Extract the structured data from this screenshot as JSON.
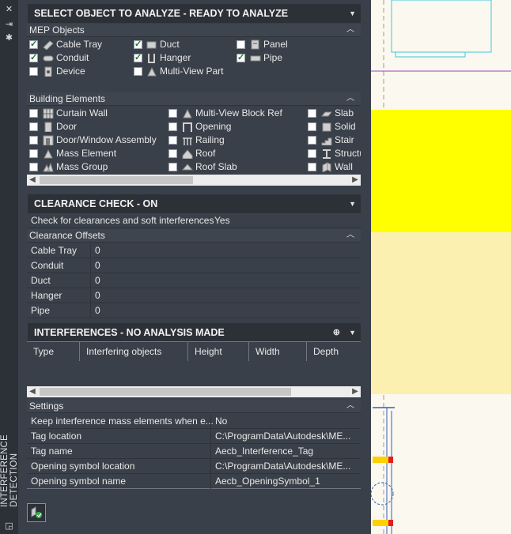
{
  "palette_title": "INTERFERENCE DETECTION",
  "select_header": "SELECT OBJECT TO ANALYZE - READY TO ANALYZE",
  "mep_objects": {
    "label": "MEP Objects",
    "items": [
      {
        "label": "Cable Tray",
        "checked": true,
        "icon": "cable-tray-icon"
      },
      {
        "label": "Duct",
        "checked": true,
        "icon": "duct-icon"
      },
      {
        "label": "Panel",
        "checked": false,
        "icon": "panel-icon"
      },
      {
        "label": "Conduit",
        "checked": true,
        "icon": "conduit-icon"
      },
      {
        "label": "Hanger",
        "checked": true,
        "icon": "hanger-icon"
      },
      {
        "label": "Pipe",
        "checked": true,
        "icon": "pipe-icon"
      },
      {
        "label": "Device",
        "checked": false,
        "icon": "device-icon"
      },
      {
        "label": "Multi-View Part",
        "checked": false,
        "icon": "multi-view-part-icon"
      }
    ]
  },
  "building_elements": {
    "label": "Building Elements",
    "items": [
      {
        "label": "Curtain Wall",
        "checked": false,
        "icon": "curtain-wall-icon"
      },
      {
        "label": "Multi-View Block Ref",
        "checked": false,
        "icon": "multi-view-block-icon"
      },
      {
        "label": "Slab",
        "checked": false,
        "icon": "slab-icon"
      },
      {
        "label": "Door",
        "checked": false,
        "icon": "door-icon"
      },
      {
        "label": "Opening",
        "checked": false,
        "icon": "opening-icon"
      },
      {
        "label": "Solid",
        "checked": false,
        "icon": "solid-icon"
      },
      {
        "label": "Door/Window Assembly",
        "checked": false,
        "icon": "door-window-assembly-icon"
      },
      {
        "label": "Railing",
        "checked": false,
        "icon": "railing-icon"
      },
      {
        "label": "Stair",
        "checked": false,
        "icon": "stair-icon"
      },
      {
        "label": "Mass Element",
        "checked": false,
        "icon": "mass-element-icon"
      },
      {
        "label": "Roof",
        "checked": false,
        "icon": "roof-icon"
      },
      {
        "label": "Structu",
        "checked": false,
        "icon": "structural-member-icon"
      },
      {
        "label": "Mass Group",
        "checked": false,
        "icon": "mass-group-icon"
      },
      {
        "label": "Roof Slab",
        "checked": false,
        "icon": "roof-slab-icon"
      },
      {
        "label": "Wall",
        "checked": false,
        "icon": "wall-icon"
      }
    ]
  },
  "clearance": {
    "header": "CLEARANCE CHECK - ON",
    "check_label": "Check for clearances and soft interferences",
    "check_value": "Yes",
    "offsets_label": "Clearance Offsets",
    "offsets": [
      {
        "label": "Cable Tray",
        "value": "0"
      },
      {
        "label": "Conduit",
        "value": "0"
      },
      {
        "label": "Duct",
        "value": "0"
      },
      {
        "label": "Hanger",
        "value": "0"
      },
      {
        "label": "Pipe",
        "value": "0"
      }
    ]
  },
  "interferences": {
    "header": "INTERFERENCES - NO ANALYSIS MADE",
    "columns": [
      "Type",
      "Interfering objects",
      "Height",
      "Width",
      "Depth"
    ]
  },
  "settings": {
    "label": "Settings",
    "rows": [
      {
        "label": "Keep interference mass elements when e...",
        "value": "No"
      },
      {
        "label": "Tag location",
        "value": "C:\\ProgramData\\Autodesk\\ME..."
      },
      {
        "label": "Tag name",
        "value": "Aecb_Interference_Tag"
      },
      {
        "label": "Opening symbol location",
        "value": "C:\\ProgramData\\Autodesk\\ME..."
      },
      {
        "label": "Opening symbol name",
        "value": "Aecb_OpeningSymbol_1"
      }
    ]
  },
  "colors": {
    "panel_bg": "#3a4049",
    "header_bg": "#2c3138",
    "accent_yellow": "#ffff00",
    "drawing_cyan": "#3ec7e0",
    "drawing_magenta": "#a040c0"
  }
}
